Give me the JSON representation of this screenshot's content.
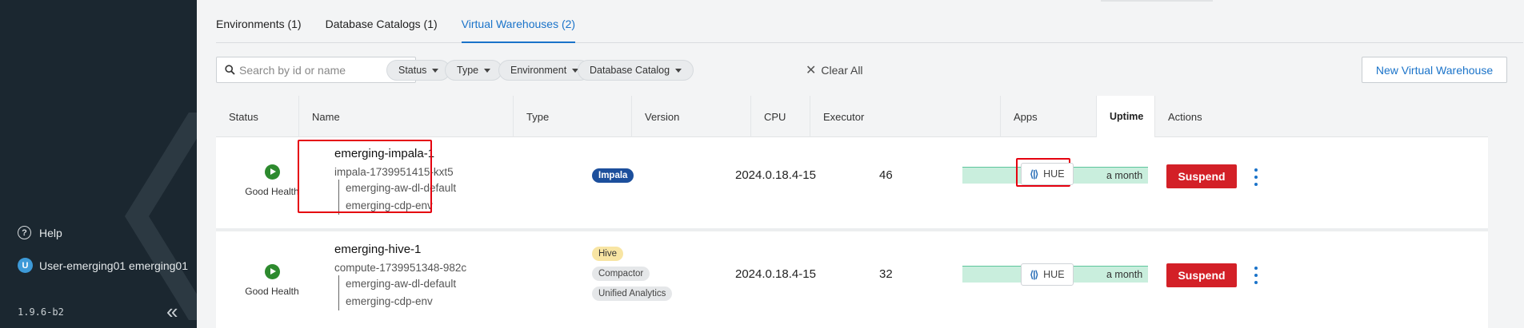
{
  "sidebar": {
    "help_label": "Help",
    "user_initial": "U",
    "user_label": "User-emerging01 emerging01",
    "version": "1.9.6-b2",
    "collapse_glyph": "«"
  },
  "tabs": [
    {
      "label": "Environments (1)",
      "active": false
    },
    {
      "label": "Database Catalogs (1)",
      "active": false
    },
    {
      "label": "Virtual Warehouses (2)",
      "active": true
    }
  ],
  "toolbar": {
    "search_placeholder": "Search by id or name",
    "filters": [
      "Status",
      "Type",
      "Environment",
      "Database Catalog"
    ],
    "clear_all": "Clear All",
    "new_button": "New Virtual Warehouse"
  },
  "table": {
    "columns": [
      "Status",
      "Name",
      "Type",
      "Version",
      "CPU",
      "Executor",
      "Apps",
      "Uptime",
      "Actions"
    ],
    "rows": [
      {
        "status": "Good Health",
        "name": "emerging-impala-1",
        "id": "impala-1739951415-kxt5",
        "sub1": "emerging-aw-dl-default",
        "sub2": "emerging-cdp-env",
        "types": [
          "Impala"
        ],
        "version": "2024.0.18.4-15",
        "cpu": "46",
        "app": "HUE",
        "uptime": "a month",
        "action": "Suspend"
      },
      {
        "status": "Good Health",
        "name": "emerging-hive-1",
        "id": "compute-1739951348-982c",
        "sub1": "emerging-aw-dl-default",
        "sub2": "emerging-cdp-env",
        "types": [
          "Hive",
          "Compactor",
          "Unified Analytics"
        ],
        "version": "2024.0.18.4-15",
        "cpu": "32",
        "app": "HUE",
        "uptime": "a month",
        "action": "Suspend"
      }
    ]
  },
  "colors": {
    "sidebar_bg": "#1b2730",
    "accent": "#1a73c9",
    "healthy": "#2d8a2e",
    "suspend": "#d32027",
    "highlight_box": "#e5000f",
    "impala_badge": "#1c4f9c",
    "hive_badge": "#f8e5a3",
    "executor_fill": "#c9eedd"
  }
}
